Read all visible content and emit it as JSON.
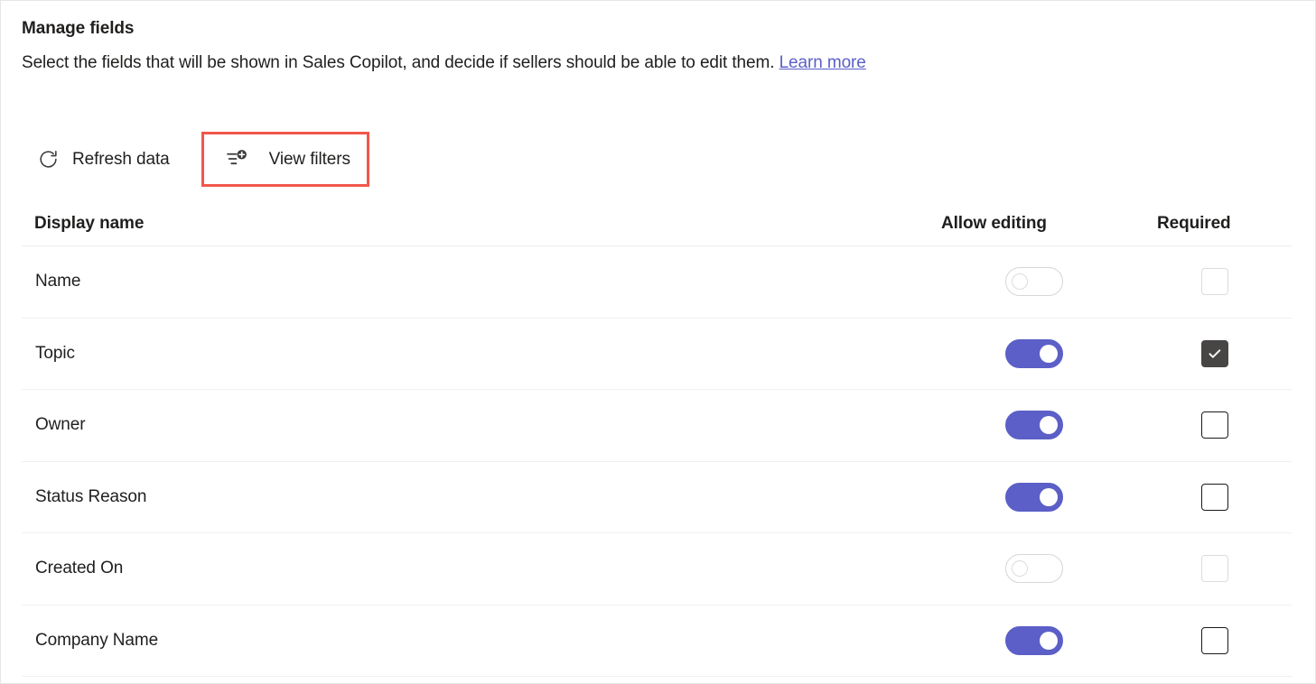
{
  "header": {
    "title": "Manage fields",
    "description_before_link": "Select the fields that will be shown in Sales Copilot, and decide if sellers should be able to edit them.",
    "link_label": "Learn more"
  },
  "toolbar": {
    "refresh_label": "Refresh data",
    "refresh_icon": "refresh-icon",
    "filters_label": "View filters",
    "filters_icon": "add-filter-icon",
    "highlight_color": "#f2564b"
  },
  "table": {
    "columns": {
      "display_name": "Display name",
      "allow_editing": "Allow editing",
      "required": "Required"
    },
    "rows": [
      {
        "name": "Name",
        "allow_editing": "off",
        "editing_disabled": true,
        "required": "unchecked",
        "required_disabled": true
      },
      {
        "name": "Topic",
        "allow_editing": "on",
        "editing_disabled": false,
        "required": "checked",
        "required_disabled": false
      },
      {
        "name": "Owner",
        "allow_editing": "on",
        "editing_disabled": false,
        "required": "unchecked",
        "required_disabled": false
      },
      {
        "name": "Status Reason",
        "allow_editing": "on",
        "editing_disabled": false,
        "required": "unchecked",
        "required_disabled": false
      },
      {
        "name": "Created On",
        "allow_editing": "off",
        "editing_disabled": true,
        "required": "unchecked",
        "required_disabled": true
      },
      {
        "name": "Company Name",
        "allow_editing": "on",
        "editing_disabled": false,
        "required": "unchecked",
        "required_disabled": false
      }
    ]
  },
  "colors": {
    "accent": "#5b5fc7",
    "checked_box": "#484644",
    "text": "#201f1e",
    "link": "#5b5fc7",
    "separator": "#f0f0f0"
  }
}
